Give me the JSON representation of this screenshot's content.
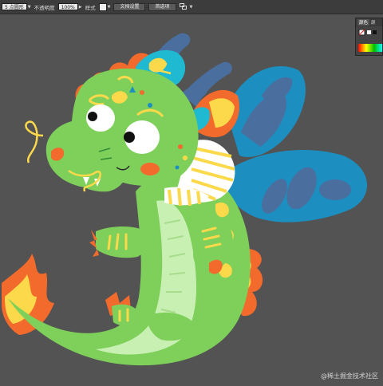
{
  "toolbar": {
    "point_size": "5 点圆形",
    "opacity_label": "不透明度",
    "opacity_value": "100%",
    "style_label": "样式",
    "doc_setup_button": "文档设置",
    "preferences_button": "首选项"
  },
  "color_panel": {
    "tab_color": "颜色",
    "tab_guide": "颜"
  },
  "watermark": "@稀土掘金技术社区",
  "colors": {
    "canvas_bg": "#535353",
    "dragon_body": "#7ed05a",
    "wing_blue": "#1c8fc0",
    "belly": "#c9f0b3",
    "horn_blue": "#4a6e9e",
    "accent_orange": "#f26a2c",
    "accent_yellow": "#fcd94a"
  }
}
